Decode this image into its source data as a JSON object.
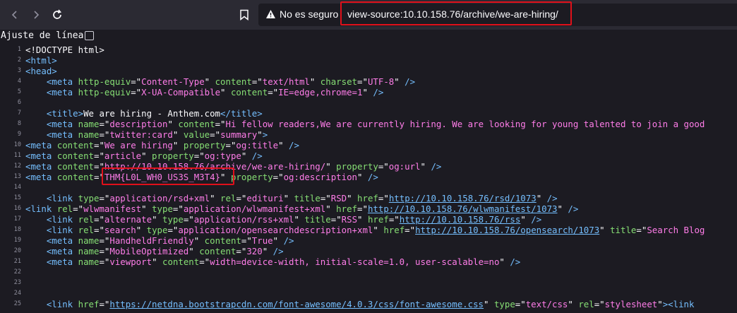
{
  "browser": {
    "security_label": "No es seguro",
    "url": "view-source:10.10.158.76/archive/we-are-hiring/"
  },
  "viewsource": {
    "wrap_label": "Ajuste de línea"
  },
  "lines": [
    {
      "n": "1",
      "indent": 0,
      "parts": [
        [
          "s",
          "<!DOCTYPE html>"
        ]
      ]
    },
    {
      "n": "2",
      "indent": 0,
      "parts": [
        [
          "t",
          "<html>"
        ]
      ]
    },
    {
      "n": "3",
      "indent": 0,
      "parts": [
        [
          "t",
          "<head>"
        ]
      ]
    },
    {
      "n": "4",
      "indent": 4,
      "parts": [
        [
          "t",
          "<meta "
        ],
        [
          "a",
          "http-equiv"
        ],
        [
          "s",
          "=\""
        ],
        [
          "v",
          "Content-Type"
        ],
        [
          "s",
          "\" "
        ],
        [
          "a",
          "content"
        ],
        [
          "s",
          "=\""
        ],
        [
          "v",
          "text/html"
        ],
        [
          "s",
          "\" "
        ],
        [
          "a",
          "charset"
        ],
        [
          "s",
          "=\""
        ],
        [
          "v",
          "UTF-8"
        ],
        [
          "s",
          "\" "
        ],
        [
          "t",
          "/>"
        ]
      ]
    },
    {
      "n": "5",
      "indent": 4,
      "parts": [
        [
          "t",
          "<meta "
        ],
        [
          "a",
          "http-equiv"
        ],
        [
          "s",
          "=\""
        ],
        [
          "v",
          "X-UA-Compatible"
        ],
        [
          "s",
          "\" "
        ],
        [
          "a",
          "content"
        ],
        [
          "s",
          "=\""
        ],
        [
          "v",
          "IE=edge,chrome=1"
        ],
        [
          "s",
          "\" "
        ],
        [
          "t",
          "/>"
        ]
      ]
    },
    {
      "n": "6",
      "indent": 0,
      "parts": []
    },
    {
      "n": "7",
      "indent": 4,
      "parts": [
        [
          "t",
          "<title>"
        ],
        [
          "s",
          "We are hiring - Anthem.com"
        ],
        [
          "t",
          "</title>"
        ]
      ]
    },
    {
      "n": "8",
      "indent": 4,
      "parts": [
        [
          "t",
          "<meta "
        ],
        [
          "a",
          "name"
        ],
        [
          "s",
          "=\""
        ],
        [
          "v",
          "description"
        ],
        [
          "s",
          "\" "
        ],
        [
          "a",
          "content"
        ],
        [
          "s",
          "=\""
        ],
        [
          "v",
          "Hi fellow readers,We are currently hiring. We are looking for young talented to join a good"
        ]
      ]
    },
    {
      "n": "9",
      "indent": 4,
      "parts": [
        [
          "t",
          "<meta "
        ],
        [
          "a",
          "name"
        ],
        [
          "s",
          "=\""
        ],
        [
          "v",
          "twitter:card"
        ],
        [
          "s",
          "\" "
        ],
        [
          "a",
          "value"
        ],
        [
          "s",
          "=\""
        ],
        [
          "v",
          "summary"
        ],
        [
          "s",
          "\""
        ],
        [
          "t",
          ">"
        ]
      ]
    },
    {
      "n": "10",
      "indent": 0,
      "parts": [
        [
          "t",
          "<meta "
        ],
        [
          "a",
          "content"
        ],
        [
          "s",
          "=\""
        ],
        [
          "v",
          "We are hiring"
        ],
        [
          "s",
          "\" "
        ],
        [
          "a",
          "property"
        ],
        [
          "s",
          "=\""
        ],
        [
          "v",
          "og:title"
        ],
        [
          "s",
          "\" "
        ],
        [
          "t",
          "/>"
        ]
      ]
    },
    {
      "n": "11",
      "indent": 0,
      "parts": [
        [
          "t",
          "<meta "
        ],
        [
          "a",
          "content"
        ],
        [
          "s",
          "=\""
        ],
        [
          "v",
          "article"
        ],
        [
          "s",
          "\" "
        ],
        [
          "a",
          "property"
        ],
        [
          "s",
          "=\""
        ],
        [
          "v",
          "og:type"
        ],
        [
          "s",
          "\" "
        ],
        [
          "t",
          "/>"
        ]
      ]
    },
    {
      "n": "12",
      "indent": 0,
      "parts": [
        [
          "t",
          "<meta "
        ],
        [
          "a",
          "content"
        ],
        [
          "s",
          "=\""
        ],
        [
          "v",
          "http://10.10.158.76/archive/we-are-hiring/"
        ],
        [
          "s",
          "\" "
        ],
        [
          "a",
          "property"
        ],
        [
          "s",
          "=\""
        ],
        [
          "v",
          "og:url"
        ],
        [
          "s",
          "\" "
        ],
        [
          "t",
          "/>"
        ]
      ]
    },
    {
      "n": "13",
      "indent": 0,
      "parts": [
        [
          "t",
          "<meta "
        ],
        [
          "a",
          "content"
        ],
        [
          "s",
          "=\""
        ],
        [
          "v",
          "THM{L0L_WH0_US3S_M3T4}"
        ],
        [
          "s",
          "\" "
        ],
        [
          "a",
          "property"
        ],
        [
          "s",
          "=\""
        ],
        [
          "v",
          "og:description"
        ],
        [
          "s",
          "\" "
        ],
        [
          "t",
          "/>"
        ]
      ]
    },
    {
      "n": "14",
      "indent": 0,
      "parts": []
    },
    {
      "n": "15",
      "indent": 4,
      "parts": [
        [
          "t",
          "<link "
        ],
        [
          "a",
          "type"
        ],
        [
          "s",
          "=\""
        ],
        [
          "v",
          "application/rsd+xml"
        ],
        [
          "s",
          "\" "
        ],
        [
          "a",
          "rel"
        ],
        [
          "s",
          "=\""
        ],
        [
          "v",
          "edituri"
        ],
        [
          "s",
          "\" "
        ],
        [
          "a",
          "title"
        ],
        [
          "s",
          "=\""
        ],
        [
          "v",
          "RSD"
        ],
        [
          "s",
          "\" "
        ],
        [
          "a",
          "href"
        ],
        [
          "s",
          "=\""
        ],
        [
          "lnk",
          "http://10.10.158.76/rsd/1073"
        ],
        [
          "s",
          "\" "
        ],
        [
          "t",
          "/>"
        ]
      ]
    },
    {
      "n": "16",
      "indent": 0,
      "parts": [
        [
          "t",
          "<link "
        ],
        [
          "a",
          "rel"
        ],
        [
          "s",
          "=\""
        ],
        [
          "v",
          "wlwmanifest"
        ],
        [
          "s",
          "\" "
        ],
        [
          "a",
          "type"
        ],
        [
          "s",
          "=\""
        ],
        [
          "v",
          "application/wlwmanifest+xml"
        ],
        [
          "s",
          "\" "
        ],
        [
          "a",
          "href"
        ],
        [
          "s",
          "=\""
        ],
        [
          "lnk",
          "http://10.10.158.76/wlwmanifest/1073"
        ],
        [
          "s",
          "\" "
        ],
        [
          "t",
          "/>"
        ]
      ]
    },
    {
      "n": "17",
      "indent": 4,
      "parts": [
        [
          "t",
          "<link "
        ],
        [
          "a",
          "rel"
        ],
        [
          "s",
          "=\""
        ],
        [
          "v",
          "alternate"
        ],
        [
          "s",
          "\" "
        ],
        [
          "a",
          "type"
        ],
        [
          "s",
          "=\""
        ],
        [
          "v",
          "application/rss+xml"
        ],
        [
          "s",
          "\" "
        ],
        [
          "a",
          "title"
        ],
        [
          "s",
          "=\""
        ],
        [
          "v",
          "RSS"
        ],
        [
          "s",
          "\" "
        ],
        [
          "a",
          "href"
        ],
        [
          "s",
          "=\""
        ],
        [
          "lnk",
          "http://10.10.158.76/rss"
        ],
        [
          "s",
          "\" "
        ],
        [
          "t",
          "/>"
        ]
      ]
    },
    {
      "n": "18",
      "indent": 4,
      "parts": [
        [
          "t",
          "<link "
        ],
        [
          "a",
          "rel"
        ],
        [
          "s",
          "=\""
        ],
        [
          "v",
          "search"
        ],
        [
          "s",
          "\" "
        ],
        [
          "a",
          "type"
        ],
        [
          "s",
          "=\""
        ],
        [
          "v",
          "application/opensearchdescription+xml"
        ],
        [
          "s",
          "\" "
        ],
        [
          "a",
          "href"
        ],
        [
          "s",
          "=\""
        ],
        [
          "lnk",
          "http://10.10.158.76/opensearch/1073"
        ],
        [
          "s",
          "\" "
        ],
        [
          "a",
          "title"
        ],
        [
          "s",
          "=\""
        ],
        [
          "v",
          "Search Blog"
        ]
      ]
    },
    {
      "n": "19",
      "indent": 4,
      "parts": [
        [
          "t",
          "<meta "
        ],
        [
          "a",
          "name"
        ],
        [
          "s",
          "=\""
        ],
        [
          "v",
          "HandheldFriendly"
        ],
        [
          "s",
          "\" "
        ],
        [
          "a",
          "content"
        ],
        [
          "s",
          "=\""
        ],
        [
          "v",
          "True"
        ],
        [
          "s",
          "\" "
        ],
        [
          "t",
          "/>"
        ]
      ]
    },
    {
      "n": "20",
      "indent": 4,
      "parts": [
        [
          "t",
          "<meta "
        ],
        [
          "a",
          "name"
        ],
        [
          "s",
          "=\""
        ],
        [
          "v",
          "MobileOptimized"
        ],
        [
          "s",
          "\" "
        ],
        [
          "a",
          "content"
        ],
        [
          "s",
          "=\""
        ],
        [
          "v",
          "320"
        ],
        [
          "s",
          "\" "
        ],
        [
          "t",
          "/>"
        ]
      ]
    },
    {
      "n": "21",
      "indent": 4,
      "parts": [
        [
          "t",
          "<meta "
        ],
        [
          "a",
          "name"
        ],
        [
          "s",
          "=\""
        ],
        [
          "v",
          "viewport"
        ],
        [
          "s",
          "\" "
        ],
        [
          "a",
          "content"
        ],
        [
          "s",
          "=\""
        ],
        [
          "v",
          "width=device-width, initial-scale=1.0, user-scalable=no"
        ],
        [
          "s",
          "\" "
        ],
        [
          "t",
          "/>"
        ]
      ]
    },
    {
      "n": "22",
      "indent": 0,
      "parts": []
    },
    {
      "n": "23",
      "indent": 0,
      "parts": []
    },
    {
      "n": "24",
      "indent": 0,
      "parts": []
    },
    {
      "n": "25",
      "indent": 4,
      "parts": [
        [
          "t",
          "<link "
        ],
        [
          "a",
          "href"
        ],
        [
          "s",
          "=\""
        ],
        [
          "lnk",
          "https://netdna.bootstrapcdn.com/font-awesome/4.0.3/css/font-awesome.css"
        ],
        [
          "s",
          "\" "
        ],
        [
          "a",
          "type"
        ],
        [
          "s",
          "=\""
        ],
        [
          "v",
          "text/css"
        ],
        [
          "s",
          "\" "
        ],
        [
          "a",
          "rel"
        ],
        [
          "s",
          "=\""
        ],
        [
          "v",
          "stylesheet"
        ],
        [
          "s",
          "\""
        ],
        [
          "t",
          "><link"
        ]
      ]
    }
  ]
}
